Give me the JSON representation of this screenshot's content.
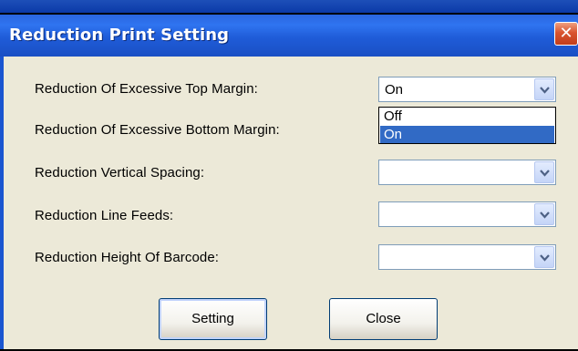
{
  "window": {
    "title": "Reduction Print Setting",
    "close_glyph": "✕"
  },
  "settings": [
    {
      "label": "Reduction Of Excessive Top Margin:",
      "value": "On"
    },
    {
      "label": "Reduction Of Excessive Bottom Margin:",
      "value": ""
    },
    {
      "label": "Reduction Vertical Spacing:",
      "value": ""
    },
    {
      "label": "Reduction Line Feeds:",
      "value": ""
    },
    {
      "label": "Reduction Height Of Barcode:",
      "value": ""
    }
  ],
  "dropdown": {
    "options": [
      "Off",
      "On"
    ],
    "highlighted": "On"
  },
  "buttons": {
    "setting": "Setting",
    "close": "Close"
  },
  "colors": {
    "titlebar": "#1f5cd8",
    "face": "#ece9d8",
    "selection": "#316ac5"
  },
  "icons": {
    "close": "close-icon",
    "arrow": "chevron-down-icon"
  }
}
